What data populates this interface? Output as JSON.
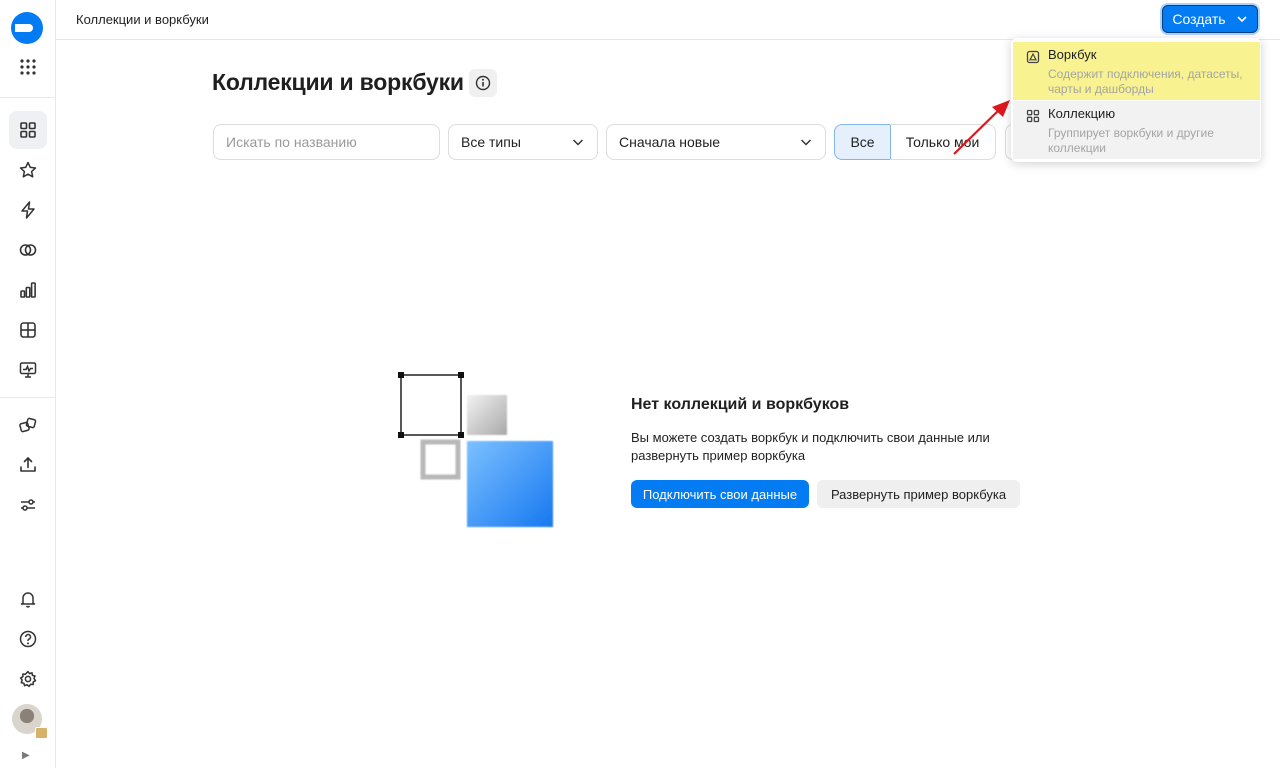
{
  "header": {
    "title": "Коллекции и воркбуки",
    "create_label": "Создать"
  },
  "sidebar": {
    "items": [
      {
        "icon": "logo-icon"
      },
      {
        "icon": "apps-grid-icon"
      },
      {
        "icon": "collections-icon",
        "active": true
      },
      {
        "icon": "star-icon"
      },
      {
        "icon": "lightning-icon"
      },
      {
        "icon": "connections-icon"
      },
      {
        "icon": "charts-icon"
      },
      {
        "icon": "datasets-icon"
      },
      {
        "icon": "dashboards-icon"
      },
      {
        "icon": "workbooks-icon"
      },
      {
        "icon": "upload-icon"
      },
      {
        "icon": "settings-sliders-icon"
      },
      {
        "icon": "bell-icon"
      },
      {
        "icon": "help-icon"
      },
      {
        "icon": "gear-icon"
      },
      {
        "icon": "avatar"
      }
    ],
    "collapse_glyph": "▶"
  },
  "page": {
    "title": "Коллекции и воркбуки"
  },
  "filters": {
    "search_placeholder": "Искать по названию",
    "type_select": "Все типы",
    "sort_select": "Сначала новые",
    "segment_all": "Все",
    "segment_mine": "Только мои"
  },
  "dropdown": {
    "items": [
      {
        "title": "Воркбук",
        "description": "Содержит подключения, датасеты, чарты и дашборды"
      },
      {
        "title": "Коллекцию",
        "description": "Группирует воркбуки и другие коллекции"
      }
    ]
  },
  "empty_state": {
    "title": "Нет коллекций и воркбуков",
    "description": "Вы можете создать воркбук и подключить свои данные или развернуть пример воркбука",
    "primary_button": "Подключить свои данные",
    "secondary_button": "Развернуть пример воркбука"
  },
  "colors": {
    "accent": "#027bf3",
    "highlight": "#f9f291",
    "arrow": "#e0161d"
  }
}
